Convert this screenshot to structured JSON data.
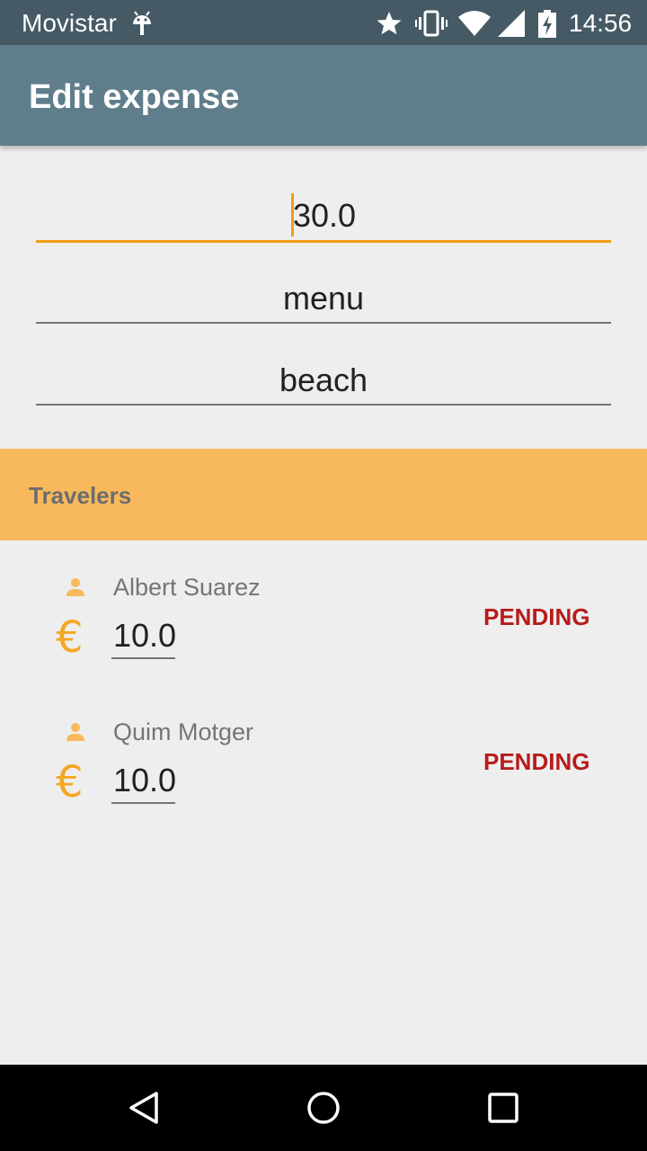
{
  "status_bar": {
    "carrier": "Movistar",
    "time": "14:56",
    "icons": [
      "android-icon",
      "star-icon",
      "vibrate-icon",
      "wifi-icon",
      "signal-icon",
      "battery-charging-icon"
    ]
  },
  "app_bar": {
    "title": "Edit expense",
    "background": "#607d8b"
  },
  "form": {
    "amount": "30.0",
    "description": "menu",
    "category": "beach",
    "accent": "#f39c12"
  },
  "travelers": {
    "header": "Travelers",
    "header_background": "#f7b95c",
    "items": [
      {
        "name": "Albert Suarez",
        "currency_icon": "euro-icon",
        "amount": "10.0",
        "status": "PENDING"
      },
      {
        "name": "Quim Motger",
        "currency_icon": "euro-icon",
        "amount": "10.0",
        "status": "PENDING"
      }
    ],
    "status_color": "#b71c1c"
  },
  "nav_bar": {
    "icons": [
      "back-icon",
      "home-icon",
      "recents-icon"
    ]
  }
}
